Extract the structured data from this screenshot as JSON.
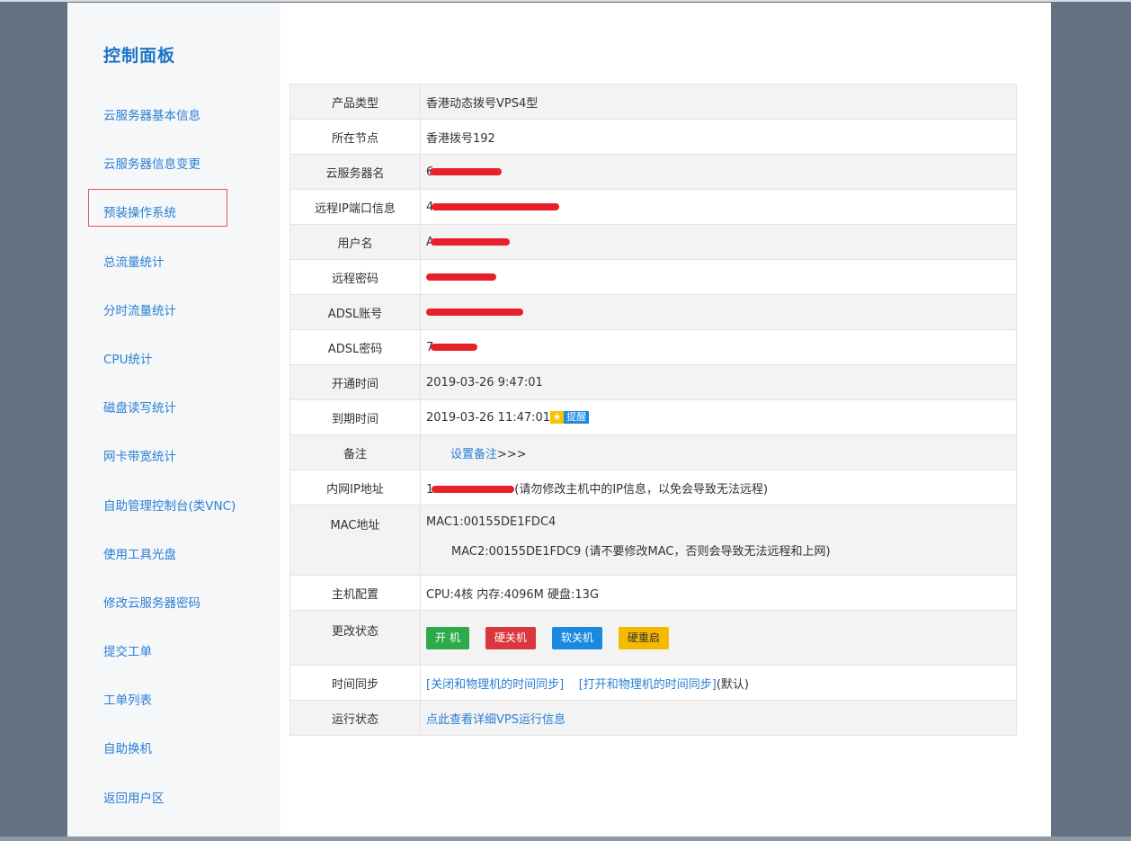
{
  "sidebar": {
    "title": "控制面板",
    "items": [
      {
        "label": "云服务器基本信息"
      },
      {
        "label": "云服务器信息变更"
      },
      {
        "label": "预装操作系统"
      },
      {
        "label": "总流量统计"
      },
      {
        "label": "分时流量统计"
      },
      {
        "label": "CPU统计"
      },
      {
        "label": "磁盘读写统计"
      },
      {
        "label": "网卡带宽统计"
      },
      {
        "label": "自助管理控制台(类VNC)"
      },
      {
        "label": "使用工具光盘"
      },
      {
        "label": "修改云服务器密码"
      },
      {
        "label": "提交工单"
      },
      {
        "label": "工单列表"
      },
      {
        "label": "自助换机"
      },
      {
        "label": "返回用户区"
      }
    ]
  },
  "info": {
    "product_type": {
      "label": "产品类型",
      "value": "香港动态拨号VPS4型"
    },
    "node": {
      "label": "所在节点",
      "value": "香港拨号192"
    },
    "server_name": {
      "label": "云服务器名",
      "value": "6"
    },
    "remote_ip": {
      "label": "远程IP端口信息",
      "value": "4"
    },
    "username": {
      "label": "用户名",
      "value": "A"
    },
    "remote_password": {
      "label": "远程密码",
      "value": ""
    },
    "adsl_account": {
      "label": "ADSL账号",
      "value": ""
    },
    "adsl_password": {
      "label": "ADSL密码",
      "value": "7"
    },
    "open_time": {
      "label": "开通时间",
      "value": "2019-03-26 9:47:01"
    },
    "expire_time": {
      "label": "到期时间",
      "value": "2019-03-26 11:47:01",
      "remind": "提醒"
    },
    "remark": {
      "label": "备注",
      "link": "设置备注",
      "suffix": ">>>"
    },
    "lan_ip": {
      "label": "内网IP地址",
      "value": "1",
      "note": "(请勿修改主机中的IP信息，以免会导致无法远程)"
    },
    "mac": {
      "label": "MAC地址",
      "mac1": "MAC1:00155DE1FDC4",
      "mac2": "MAC2:00155DE1FDC9 (请不要修改MAC，否则会导致无法远程和上网)"
    },
    "host_config": {
      "label": "主机配置",
      "value": "CPU:4核 内存:4096M 硬盘:13G"
    },
    "change_state": {
      "label": "更改状态",
      "btn_on": "开 机",
      "btn_hard_off": "硬关机",
      "btn_soft_off": "软关机",
      "btn_hard_reboot": "硬重启"
    },
    "time_sync": {
      "label": "时间同步",
      "link_off": "[关闭和物理机的时间同步]",
      "link_on": "[打开和物理机的时间同步]",
      "default": "(默认)"
    },
    "run_state": {
      "label": "运行状态",
      "link": "点此查看详细VPS运行信息"
    }
  },
  "colors": {
    "accent": "#2a7fd4",
    "btn_green": "#2eaa4a",
    "btn_red": "#d9363e",
    "btn_blue": "#1a8ae0",
    "btn_yellow": "#f5b900"
  }
}
